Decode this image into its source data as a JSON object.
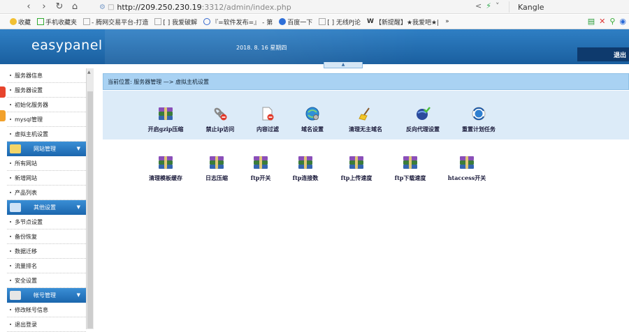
{
  "browser": {
    "url_host": "http://209.250.230.19",
    "url_path": ":3312/admin/index.php",
    "search_text": "Kangle",
    "bookmarks": [
      {
        "label": "收藏"
      },
      {
        "label": "手机收藏夹"
      },
      {
        "label": "- 腾网交易平台-打造"
      },
      {
        "label": "[        ] 我爱破解"
      },
      {
        "label": "『=软件发布=』 - 第"
      },
      {
        "label": "百度一下"
      },
      {
        "label": "[        ] 无线PJ论"
      },
      {
        "label": "【新提醒】★我爱吧★|"
      },
      {
        "label": "»"
      }
    ]
  },
  "header": {
    "logo": "easypanel",
    "date": "2018. 8. 16  星期四",
    "logout": "退出"
  },
  "sidebar": {
    "items_top": [
      "服务器信息",
      "服务器设置",
      "初始化服务器",
      "mysql管理",
      "虚拟主机设置"
    ],
    "section_site": "网站管理",
    "items_site": [
      "所有网站",
      "新增网站",
      "产品列表"
    ],
    "section_other": "其他设置",
    "items_other": [
      "多节点设置",
      "备份恢复",
      "数据迁移",
      "流量排名",
      "安全设置"
    ],
    "section_account": "帐号管理",
    "items_account": [
      "修改帐号信息",
      "退出登录"
    ]
  },
  "breadcrumb": "当前位置: 服务器管理 —> 虚拟主机设置",
  "tools_row1": [
    "开启gzip压缩",
    "禁止ip访问",
    "内容过滤",
    "域名设置",
    "清理无主域名",
    "反向代理设置",
    "重置计划任务"
  ],
  "tools_row2": [
    "清理模板缓存",
    "日志压缩",
    "ftp开关",
    "ftp连接数",
    "ftp上传速度",
    "ftp下载速度",
    "htaccess开关"
  ],
  "colors": {
    "header_blue": "#1f6cb0",
    "breadcrumb_bg": "#a9d2f3",
    "panel_bg": "#dcebf8"
  }
}
